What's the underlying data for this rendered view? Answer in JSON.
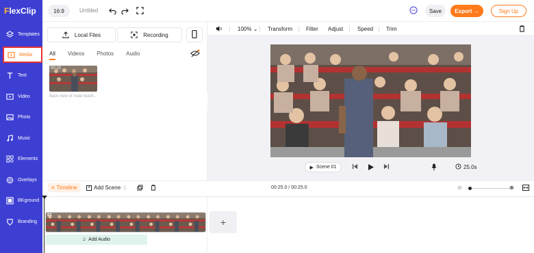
{
  "brand": {
    "prefix": "F",
    "name": "lexClip"
  },
  "sidebar": {
    "items": [
      {
        "label": "Templates",
        "icon": "templates-icon"
      },
      {
        "label": "Media",
        "icon": "media-icon",
        "active": true
      },
      {
        "label": "Text",
        "icon": "text-icon"
      },
      {
        "label": "Video",
        "icon": "video-icon"
      },
      {
        "label": "Photo",
        "icon": "photo-icon"
      },
      {
        "label": "Music",
        "icon": "music-icon"
      },
      {
        "label": "Elements",
        "icon": "elements-icon"
      },
      {
        "label": "Overlays",
        "icon": "overlays-icon"
      },
      {
        "label": "BKground",
        "icon": "background-icon"
      },
      {
        "label": "Branding",
        "icon": "branding-icon"
      }
    ]
  },
  "topbar": {
    "ratio": "16:9",
    "project_title": "Untitled",
    "save_label": "Save",
    "export_label": "Export →",
    "signup_label": "Sign Up"
  },
  "panel": {
    "local_files_label": "Local Files",
    "recording_label": "Recording",
    "tabs": [
      "All",
      "Videos",
      "Photos",
      "Audio"
    ],
    "active_tab": "All",
    "thumb_duration": "00:20",
    "thumb_caption": "Back view of male teach..."
  },
  "editor": {
    "zoom": "100%",
    "tools": [
      "Transform",
      "Filter",
      "Adjust",
      "Speed",
      "Trim"
    ]
  },
  "player": {
    "scene_label": "Scene 01",
    "duration": "25.0s"
  },
  "timeline": {
    "timeline_label": "Timeline",
    "add_scene_label": "Add Scene",
    "time_display": "00:25.0 / 00:25.0",
    "clip_number": "01",
    "add_audio_label": "Add Audio",
    "add_scene_plus": "+"
  },
  "colors": {
    "sidebar_bg": "#3d3fd3",
    "accent": "#ff7a1a",
    "selection_border": "#e53030"
  }
}
